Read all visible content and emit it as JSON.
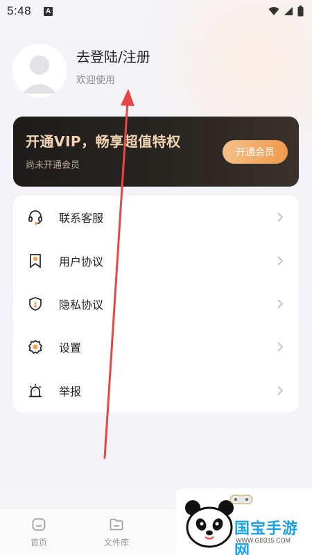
{
  "status_bar": {
    "time": "5:48",
    "notif_letter": "A"
  },
  "profile": {
    "title": "去登陆/注册",
    "subtitle": "欢迎使用"
  },
  "vip": {
    "title": "开通VIP，畅享超值特权",
    "subtitle": "尚未开通会员",
    "button": "开通会员"
  },
  "menu": {
    "items": [
      {
        "label": "联系客服",
        "icon": "headset-icon"
      },
      {
        "label": "用户协议",
        "icon": "bookmark-icon"
      },
      {
        "label": "隐私协议",
        "icon": "shield-icon"
      },
      {
        "label": "设置",
        "icon": "gear-icon"
      },
      {
        "label": "举报",
        "icon": "alarm-icon"
      }
    ]
  },
  "nav": {
    "items": [
      {
        "label": "首页",
        "icon": "home-icon"
      },
      {
        "label": "文件库",
        "icon": "folder-icon"
      }
    ]
  },
  "watermark": {
    "brand": "国宝手游网",
    "url": "WWW.GB315.COM"
  },
  "colors": {
    "accent": "#f0a04e",
    "vip_bg": "#221f1c",
    "vip_title": "#f3d5b5",
    "arrow": "#e84545",
    "brand": "#1aa3e8"
  }
}
